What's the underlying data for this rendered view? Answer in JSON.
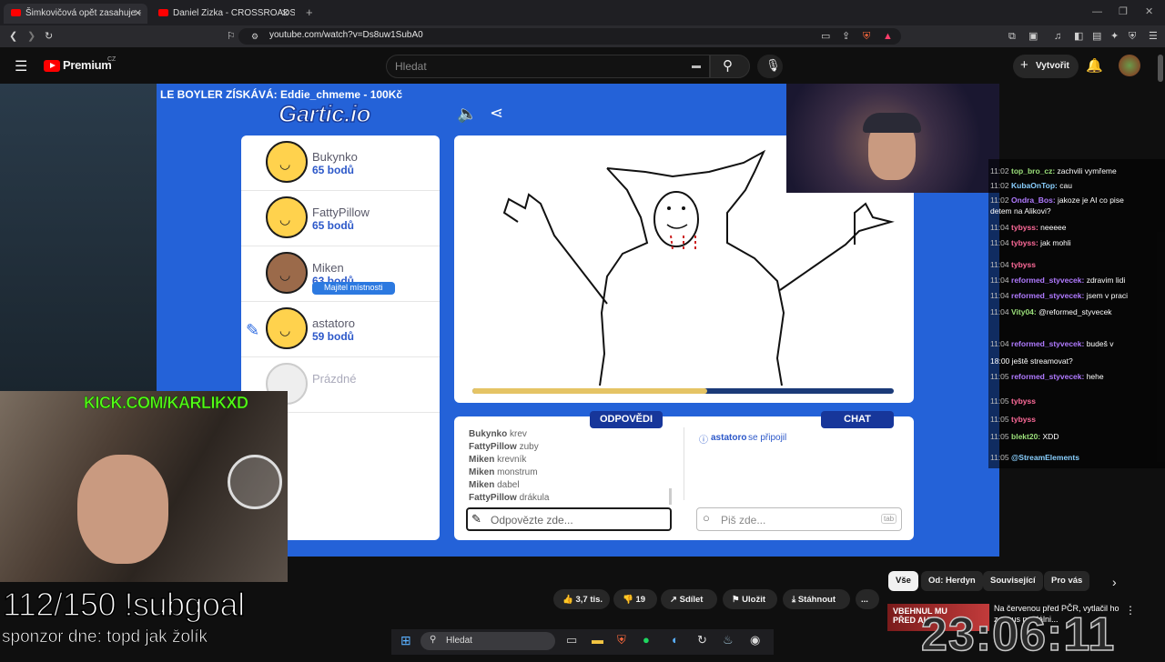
{
  "browser": {
    "tabs": [
      {
        "title": "Šimkovičová opět zasahuje -"
      },
      {
        "title": "Daniel Zizka - CROSSROADS | Czech"
      }
    ],
    "new_tab": "+",
    "url": "youtube.com/watch?v=Ds8uw1SubA0"
  },
  "youtube": {
    "logo_text": "Premium",
    "region": "CZ",
    "search_placeholder": "Hledat",
    "create_label": "Vytvořit"
  },
  "game": {
    "banner": "LE BOYLER ZÍSKÁVÁ: Eddie_chmeme - 100Kč",
    "logo": "Gartic.io",
    "players": [
      {
        "name": "Bukynko",
        "score": "65 bodů"
      },
      {
        "name": "FattyPillow",
        "score": "65 bodů"
      },
      {
        "name": "Miken",
        "score": "63 bodů"
      },
      {
        "name": "astatoro",
        "score": "59 bodů"
      },
      {
        "name": "Prázdné",
        "score": ""
      }
    ],
    "owner_badge": "Majitel místnosti",
    "round_progress": 0.56,
    "answers_tab": "ODPOVĚDI",
    "chat_tab": "CHAT",
    "answers": [
      {
        "user": "Bukynko",
        "text": "krev"
      },
      {
        "user": "FattyPillow",
        "text": "zuby"
      },
      {
        "user": "Miken",
        "text": "krevník"
      },
      {
        "user": "Miken",
        "text": "monstrum"
      },
      {
        "user": "Miken",
        "text": "dabel"
      },
      {
        "user": "FattyPillow",
        "text": "drákula"
      }
    ],
    "answer_placeholder": "Odpovězte zde...",
    "chat_placeholder": "Piš zde...",
    "tab_key": "tab",
    "joined_user": "astatoro",
    "joined_text": "se připojil"
  },
  "overlay": {
    "kick": "KICK.COM/KARLIKXD",
    "subgoal": "112/150 !subgoal",
    "sponsor": "sponzor dne: topd jak žolík",
    "clock": "23:06:11"
  },
  "stream_chat": [
    {
      "time": "11:02",
      "user": "top_bro_cz",
      "msg": "zachvili vymřeme",
      "color": "#9be07a"
    },
    {
      "time": "11:02",
      "user": "KubaOnTop",
      "msg": "cau",
      "color": "#8ad0ff"
    },
    {
      "time": "11:02",
      "user": "Ondra_Bos",
      "msg": "jakoze je AI co pise",
      "color": "#b07aff"
    },
    {
      "time": "",
      "user": "",
      "msg": "detem na Alikovi?",
      "color": "#fff"
    },
    {
      "time": "11:04",
      "user": "tybyss",
      "msg": "neeeee",
      "color": "#ff6b9a"
    },
    {
      "time": "11:04",
      "user": "tybyss",
      "msg": "jak mohli",
      "color": "#ff6b9a"
    },
    {
      "time": "11:04",
      "user": "tybyss",
      "msg": "",
      "color": "#ff6b9a"
    },
    {
      "time": "11:04",
      "user": "reformed_styvecek",
      "msg": "zdravim lidi",
      "color": "#b07aff"
    },
    {
      "time": "11:04",
      "user": "reformed_styvecek",
      "msg": "jsem v praci",
      "color": "#b07aff"
    },
    {
      "time": "11:04",
      "user": "Vity04",
      "msg": "@reformed_styvecek",
      "color": "#9be07a"
    },
    {
      "time": "11:04",
      "user": "reformed_styvecek",
      "msg": "budeš v",
      "color": "#b07aff"
    },
    {
      "time": "",
      "user": "",
      "msg": "18:00 ještě streamovat?",
      "color": "#fff"
    },
    {
      "time": "11:05",
      "user": "reformed_styvecek",
      "msg": "hehe",
      "color": "#b07aff"
    },
    {
      "time": "11:05",
      "user": "tybyss",
      "msg": "",
      "color": "#ff6b9a"
    },
    {
      "time": "11:05",
      "user": "tybyss",
      "msg": "",
      "color": "#ff6b9a"
    },
    {
      "time": "11:05",
      "user": "blekt20",
      "msg": "XDD",
      "color": "#9be07a"
    },
    {
      "time": "11:05",
      "user": "@StreamElements",
      "msg": "",
      "color": "#8ad0ff"
    }
  ],
  "video_actions": {
    "likes": "3,7 tis.",
    "dislikes": "19",
    "share": "Sdílet",
    "save": "Uložit",
    "download": "Stáhnout",
    "more": "..."
  },
  "related_chips": [
    "Vše",
    "Od: Herdyn",
    "Související",
    "Pro vás"
  ],
  "recommendation": {
    "thumb_text": "VBEHNUL MU PŘED AUTO",
    "title": "Na červenou před PČR, vytlačil ho z... ous na dálni..."
  },
  "taskbar": {
    "search": "Hledat"
  },
  "colors": {
    "gartic_blue": "#2462d8",
    "youtube_red": "#ff0000",
    "kick_green": "#53fc18"
  }
}
